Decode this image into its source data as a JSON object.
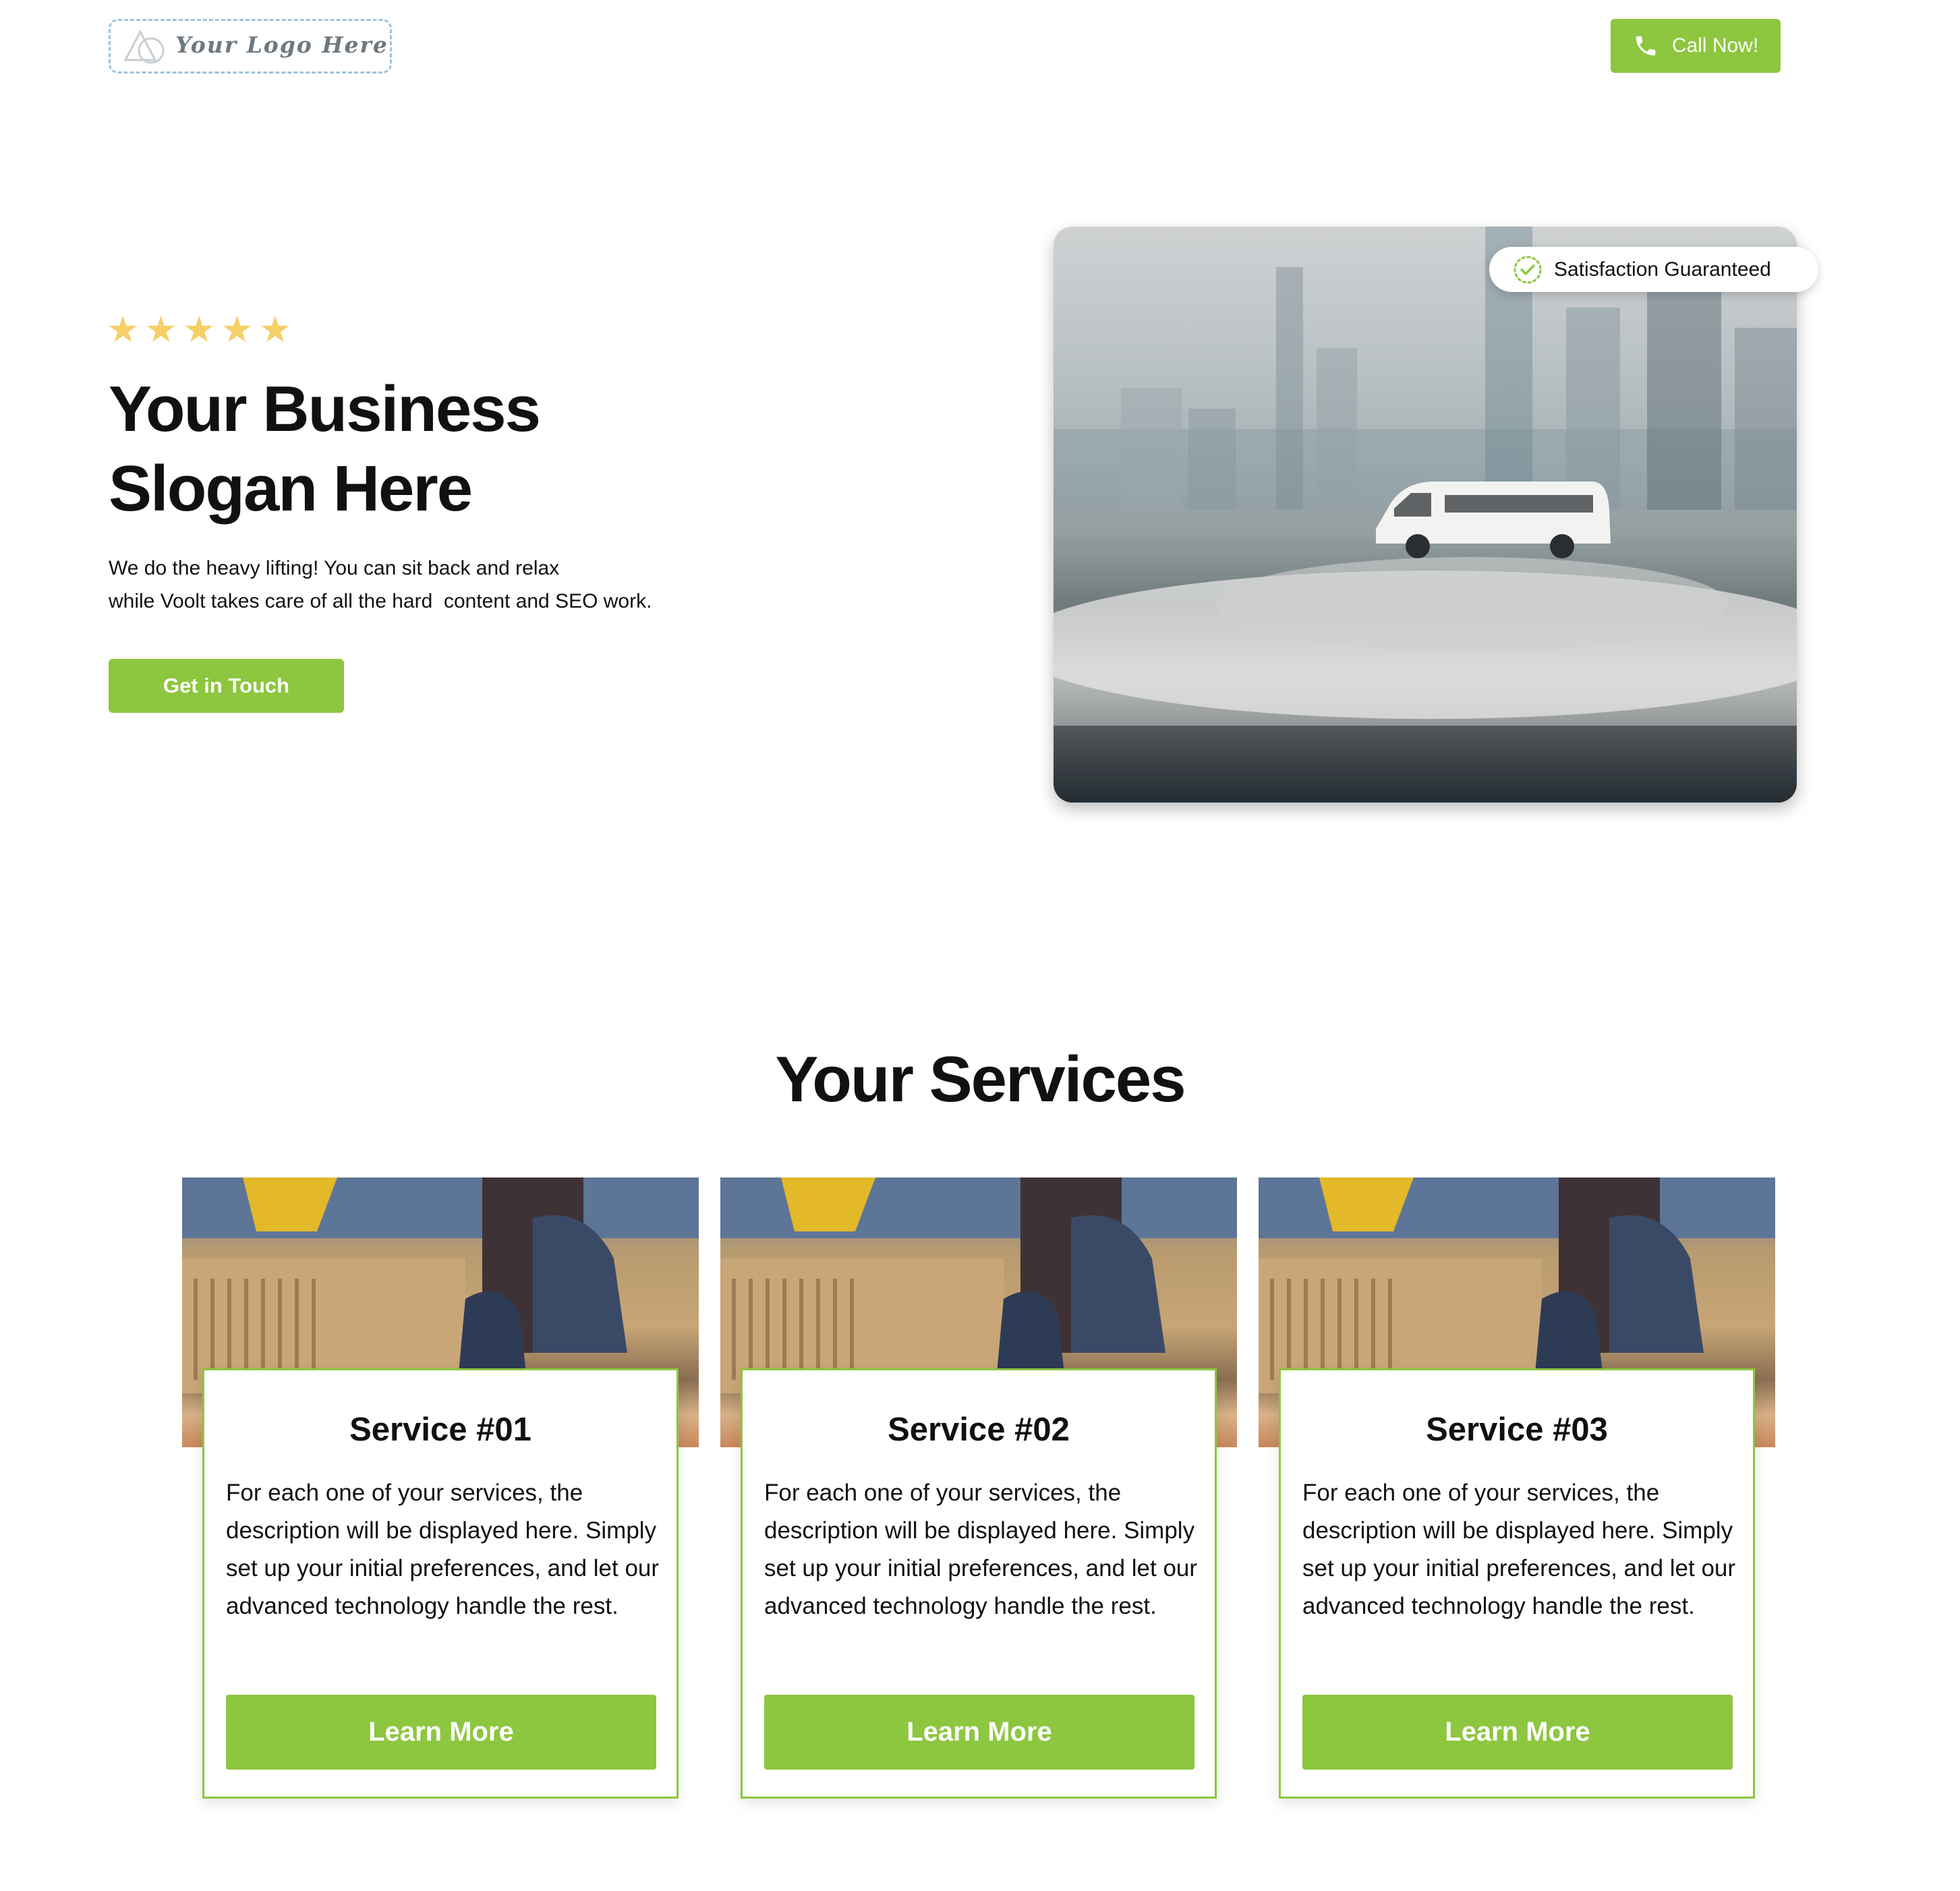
{
  "header": {
    "logo_text": "Your Logo Here",
    "call_label": "Call Now!"
  },
  "hero": {
    "rating_stars": 5,
    "title_lines": [
      "Your Business",
      "Slogan Here"
    ],
    "subtitle_lines": [
      "We do the heavy lifting! You can sit back and relax",
      "while Voolt takes care of all the hard  content and SEO work."
    ],
    "cta_label": "Get in Touch",
    "badge_text": "Satisfaction Guaranteed"
  },
  "services": {
    "title": "Your Services",
    "items": [
      {
        "title": "Service #01",
        "description": "For each one of your services, the description will be displayed here. Simply set up your initial preferences, and let our advanced technology handle the rest.",
        "button_label": "Learn More"
      },
      {
        "title": "Service #02",
        "description": "For each one of your services, the description will be displayed here. Simply set up your initial preferences, and let our advanced technology handle the rest.",
        "button_label": "Learn More"
      },
      {
        "title": "Service #03",
        "description": "For each one of your services, the description will be displayed here. Simply set up your initial preferences, and let our advanced technology handle the rest.",
        "button_label": "Learn More"
      }
    ]
  },
  "colors": {
    "accent": "#8dc63f",
    "star": "#f5cf67",
    "text": "#111111",
    "logo_border": "#9cc3df"
  },
  "icons": [
    "logo-shapes-icon",
    "phone-icon",
    "star-icon",
    "check-badge-icon"
  ]
}
